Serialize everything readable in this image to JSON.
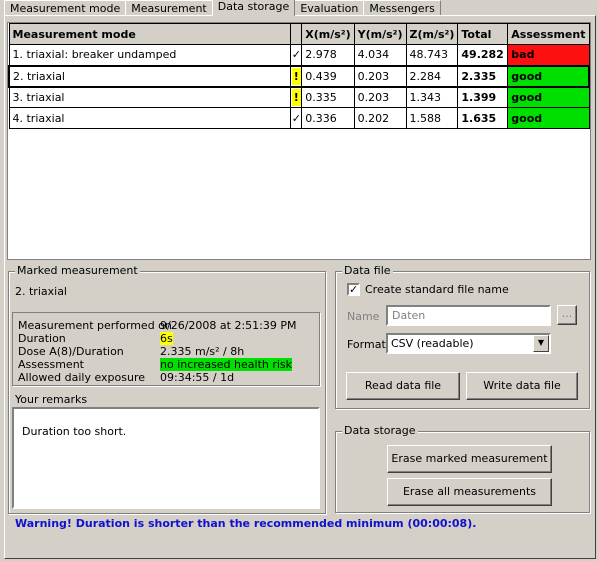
{
  "tabs": [
    "Measurement mode",
    "Measurement",
    "Data storage",
    "Evaluation",
    "Messengers"
  ],
  "table": {
    "headers": [
      "Measurement mode",
      "",
      "X(m/s²)",
      "Y(m/s²)",
      "Z(m/s²)",
      "Total",
      "Assessment"
    ],
    "rows": [
      {
        "mode": "1. triaxial: breaker undamped",
        "flag": "✓",
        "x": "2.978",
        "y": "4.034",
        "z": "48.743",
        "total": "49.282",
        "assessment": "bad"
      },
      {
        "mode": "2. triaxial",
        "flag": "!",
        "x": "0.439",
        "y": "0.203",
        "z": "2.284",
        "total": "2.335",
        "assessment": "good"
      },
      {
        "mode": "3. triaxial",
        "flag": "!",
        "x": "0.335",
        "y": "0.203",
        "z": "1.343",
        "total": "1.399",
        "assessment": "good"
      },
      {
        "mode": "4. triaxial",
        "flag": "✓",
        "x": "0.336",
        "y": "0.202",
        "z": "1.588",
        "total": "1.635",
        "assessment": "good"
      }
    ]
  },
  "marked": {
    "title": "Marked measurement",
    "name": "2. triaxial",
    "performed_label": "Measurement performed on",
    "performed_value": "9/26/2008 at 2:51:39 PM",
    "duration_label": "Duration",
    "duration_value": "6s",
    "dose_label": "Dose A(8)/Duration",
    "dose_value": "2.335 m/s² / 8h",
    "assessment_label": "Assessment",
    "assessment_value": "no increased health risk",
    "allowed_label": "Allowed daily exposure",
    "allowed_value": "09:34:55 / 1d",
    "remarks_label": "Your remarks",
    "remarks_text": "Duration too short."
  },
  "datafile": {
    "title": "Data file",
    "checkbox_label": "Create standard file name",
    "checkbox_mark": "✓",
    "name_label": "Name",
    "name_value": "Daten",
    "browse_label": "...",
    "format_label": "Format",
    "format_value": "CSV (readable)",
    "read_button": "Read data file",
    "write_button": "Write data file"
  },
  "storage": {
    "title": "Data storage",
    "erase_marked": "Erase marked measurement",
    "erase_all": "Erase all measurements"
  },
  "warning": "Warning!  Duration is shorter than the recommended minimum (00:00:08).",
  "colors": {
    "good": "#00e000",
    "bad": "#ff1010",
    "warning_flag": "#ffff00",
    "warning_text": "#1010d0"
  }
}
